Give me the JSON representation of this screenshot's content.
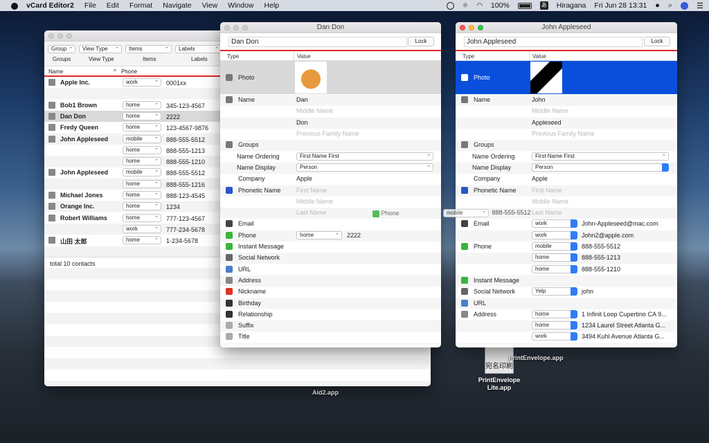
{
  "menubar": {
    "app": "vCard Editor2",
    "items": [
      "File",
      "Edit",
      "Format",
      "Navigate",
      "View",
      "Window",
      "Help"
    ],
    "battery": "100%",
    "input_method": "Hiragana",
    "datetime": "Fri Jun 28  13:31",
    "input_badge": "あ"
  },
  "list_window": {
    "toolbar": {
      "groups_value": "Group",
      "viewtype_value": "View Type",
      "items_value": "Items",
      "labels_value": "Labels",
      "groups_label": "Groups",
      "viewtype_label": "View Type",
      "items_label": "Items",
      "labels_label": "Labels"
    },
    "columns": {
      "name": "Name",
      "phone": "Phone",
      "sort_indicator": "^"
    },
    "contacts": [
      {
        "name": "Apple Inc.",
        "label": "work",
        "phone": "0001xx"
      },
      {
        "name": "",
        "label": "",
        "phone": ""
      },
      {
        "name": "Bob1 Brown",
        "label": "home",
        "phone": "345-123-4567"
      },
      {
        "name": "Dan Don",
        "label": "home",
        "phone": "2222"
      },
      {
        "name": "Fredy Queen",
        "label": "home",
        "phone": "123-4567-9876"
      },
      {
        "name": "John Appleseed",
        "label": "mobile",
        "phone": "888-555-5512"
      },
      {
        "name": "",
        "label": "home",
        "phone": "888-555-1213"
      },
      {
        "name": "",
        "label": "home",
        "phone": "888-555-1210"
      },
      {
        "name": "John Appleseed",
        "label": "mobile",
        "phone": "888-555-5512"
      },
      {
        "name": "",
        "label": "home",
        "phone": "888-555-1216"
      },
      {
        "name": "Michael Jones",
        "label": "home",
        "phone": "888-123-4545"
      },
      {
        "name": "Orange Inc.",
        "label": "home",
        "phone": "1234"
      },
      {
        "name": "Robert Williams",
        "label": "home",
        "phone": "777-123-4567"
      },
      {
        "name": "",
        "label": "work",
        "phone": "777-234-5678"
      },
      {
        "name": "山田 太郎",
        "label": "home",
        "phone": "1-234-5678"
      }
    ],
    "footer": "total 10 contacts"
  },
  "dan_window": {
    "title": "Dan Don",
    "name_field": "Dan Don",
    "lock": "Lock",
    "col_type": "Type",
    "col_value": "Value",
    "rows": {
      "photo": "Photo",
      "name": "Name",
      "groups": "Groups",
      "name_ordering": "Name Ordering",
      "name_display": "Name Display",
      "company": "Company",
      "phonetic": "Phonetic Name",
      "email": "Email",
      "phone": "Phone",
      "im": "Instant Message",
      "social": "Social Network",
      "url": "URL",
      "address": "Address",
      "nickname": "Nickname",
      "birthday": "Birthday",
      "relationship": "Relationship",
      "suffix": "Suffix",
      "title": "Title"
    },
    "values": {
      "first": "Dan",
      "middle": "Middle Name",
      "last": "Don",
      "prev_family": "Previous Family Name",
      "name_ordering": "First Name First",
      "name_display": "Person",
      "company": "Apple",
      "phon_first": "First Name",
      "phon_middle": "Middle Name",
      "phon_last": "Last Name",
      "phone_label": "home",
      "phone_value": "2222",
      "suffix_icon_text": "Suffix"
    }
  },
  "drag": {
    "phone_label": "Phone",
    "mobile_label": "mobile",
    "mobile_value": "888-555-5512"
  },
  "john_window": {
    "title": "John Appleseed",
    "name_field": "John Appleseed",
    "lock": "Lock",
    "col_type": "Type",
    "col_value": "Value",
    "rows": {
      "photo": "Photo",
      "name": "Name",
      "groups": "Groups",
      "name_ordering": "Name Ordering",
      "name_display": "Name Display",
      "company": "Company",
      "phonetic": "Phonetic Name",
      "email": "Email",
      "phone": "Phone",
      "im": "Instant Message",
      "social": "Social Network",
      "url": "URL",
      "address": "Address"
    },
    "values": {
      "first": "John",
      "middle": "Middle Name",
      "last": "Appleseed",
      "prev_family": "Previous Family Name",
      "name_ordering": "First Name First",
      "name_display": "Person",
      "company": "Apple",
      "phon_first": "First Name",
      "phon_middle": "Middle Name",
      "phon_last": "Last Name"
    },
    "emails": [
      {
        "label": "work",
        "value": "John-Appleseed@mac.com"
      },
      {
        "label": "work",
        "value": "John2@apple.com"
      }
    ],
    "phones": [
      {
        "label": "mobile",
        "value": "888-555-5512"
      },
      {
        "label": "home",
        "value": "888-555-1213"
      },
      {
        "label": "home",
        "value": "888-555-1210"
      }
    ],
    "social": {
      "label": "Yelp",
      "value": "john"
    },
    "addresses": [
      {
        "label": "home",
        "value": "1 Infinit Loop Cupertino CA 9..."
      },
      {
        "label": "home",
        "value": "1234 Laurel Street Atlanta G..."
      },
      {
        "label": "work",
        "value": "3494 Kuhl Avenue Atlanta G..."
      }
    ]
  },
  "desktop": {
    "icon1": "Aid2.app",
    "icon2a": "PrintEnvelope.app",
    "icon2b": "PrintEnvelope Lite.app",
    "envelope_glyph": "宛名印刷"
  },
  "colors": {
    "accent_red": "#e0272a",
    "selection_blue": "#0a4fdc",
    "highlight_gray": "#d9d9d9"
  }
}
